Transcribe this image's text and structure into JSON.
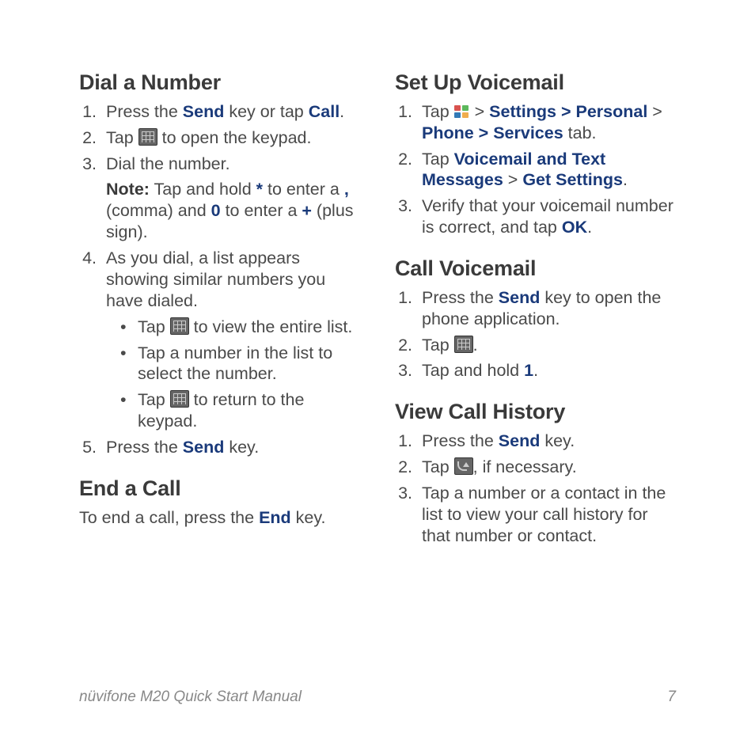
{
  "footer": {
    "title": "nüvifone M20 Quick Start Manual",
    "page": "7"
  },
  "left": {
    "s1": {
      "h": "Dial a Number",
      "i1a": "Press the ",
      "i1b": "Send",
      "i1c": " key or tap ",
      "i1d": "Call",
      "i1e": ".",
      "i2a": "Tap ",
      "i2b": " to open the keypad.",
      "i3": "Dial the number.",
      "note1": "Note:",
      "note2": " Tap and hold ",
      "note3": "*",
      "note4": " to enter a ",
      "note5": ",",
      "note6": " (comma) and ",
      "note7": "0",
      "note8": " to enter a ",
      "note9": "+",
      "note10": " (plus sign).",
      "i4": "As you dial, a list appears showing similar numbers you have dialed.",
      "b1a": "Tap ",
      "b1b": " to view the entire list.",
      "b2": "Tap a number in the list to select the number.",
      "b3a": "Tap ",
      "b3b": " to return to the keypad.",
      "i5a": "Press the ",
      "i5b": "Send",
      "i5c": " key."
    },
    "s2": {
      "h": "End a Call",
      "t1": "To end a call, press the ",
      "t2": "End",
      "t3": " key."
    }
  },
  "right": {
    "s1": {
      "h": "Set Up Voicemail",
      "i1a": "Tap ",
      "i1b": " > ",
      "i1c": "Settings > Personal",
      "i1d": " > ",
      "i1e": "Phone > Services",
      "i1f": " tab.",
      "i2a": "Tap ",
      "i2b": "Voicemail and Text Messages",
      "i2c": " > ",
      "i2d": "Get Settings",
      "i2e": ".",
      "i3a": "Verify that your voicemail number is correct, and tap ",
      "i3b": "OK",
      "i3c": "."
    },
    "s2": {
      "h": "Call Voicemail",
      "i1a": "Press the ",
      "i1b": "Send",
      "i1c": " key to open the phone application.",
      "i2a": "Tap ",
      "i2b": ".",
      "i3a": "Tap and hold ",
      "i3b": "1",
      "i3c": "."
    },
    "s3": {
      "h": "View Call History",
      "i1a": "Press the ",
      "i1b": "Send",
      "i1c": " key.",
      "i2a": "Tap ",
      "i2b": ", if necessary.",
      "i3": "Tap a number or a contact in the list to view your call history for that number or contact."
    }
  }
}
